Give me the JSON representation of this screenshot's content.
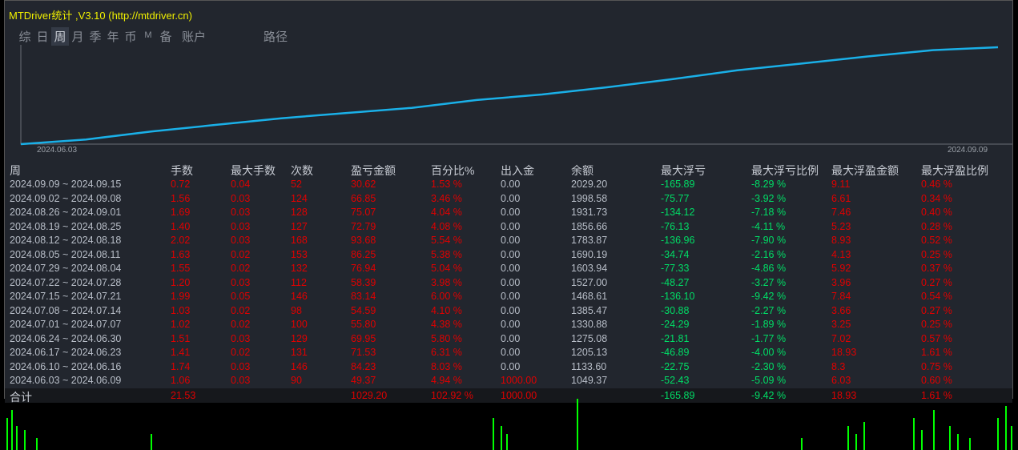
{
  "title": "MTDriver统计 ,V3.10 (http://mtdriver.cn)",
  "tabs": [
    "综",
    "日",
    "周",
    "月",
    "季",
    "年",
    "币",
    "M",
    "备",
    "账户",
    "路径"
  ],
  "active_tab": "周",
  "chart": {
    "x_start": "2024.06.03",
    "x_end": "2024.09.09",
    "line_color": "#1ab0e8"
  },
  "columns": [
    "周",
    "手数",
    "最大手数",
    "次数",
    "盈亏金额",
    "百分比%",
    "出入金",
    "余额",
    "最大浮亏",
    "最大浮亏比例",
    "最大浮盈金额",
    "最大浮盈比例"
  ],
  "rows": [
    [
      "2024.09.09 ~ 2024.09.15",
      "0.72",
      "0.04",
      "52",
      "30.62",
      "1.53 %",
      "0.00",
      "2029.20",
      "-165.89",
      "-8.29 %",
      "9.11",
      "0.46 %"
    ],
    [
      "2024.09.02 ~ 2024.09.08",
      "1.56",
      "0.03",
      "124",
      "66.85",
      "3.46 %",
      "0.00",
      "1998.58",
      "-75.77",
      "-3.92 %",
      "6.61",
      "0.34 %"
    ],
    [
      "2024.08.26 ~ 2024.09.01",
      "1.69",
      "0.03",
      "128",
      "75.07",
      "4.04 %",
      "0.00",
      "1931.73",
      "-134.12",
      "-7.18 %",
      "7.46",
      "0.40 %"
    ],
    [
      "2024.08.19 ~ 2024.08.25",
      "1.40",
      "0.03",
      "127",
      "72.79",
      "4.08 %",
      "0.00",
      "1856.66",
      "-76.13",
      "-4.11 %",
      "5.23",
      "0.28 %"
    ],
    [
      "2024.08.12 ~ 2024.08.18",
      "2.02",
      "0.03",
      "168",
      "93.68",
      "5.54 %",
      "0.00",
      "1783.87",
      "-136.96",
      "-7.90 %",
      "8.93",
      "0.52 %"
    ],
    [
      "2024.08.05 ~ 2024.08.11",
      "1.63",
      "0.02",
      "153",
      "86.25",
      "5.38 %",
      "0.00",
      "1690.19",
      "-34.74",
      "-2.16 %",
      "4.13",
      "0.25 %"
    ],
    [
      "2024.07.29 ~ 2024.08.04",
      "1.55",
      "0.02",
      "132",
      "76.94",
      "5.04 %",
      "0.00",
      "1603.94",
      "-77.33",
      "-4.86 %",
      "5.92",
      "0.37 %"
    ],
    [
      "2024.07.22 ~ 2024.07.28",
      "1.20",
      "0.03",
      "112",
      "58.39",
      "3.98 %",
      "0.00",
      "1527.00",
      "-48.27",
      "-3.27 %",
      "3.96",
      "0.27 %"
    ],
    [
      "2024.07.15 ~ 2024.07.21",
      "1.99",
      "0.05",
      "146",
      "83.14",
      "6.00 %",
      "0.00",
      "1468.61",
      "-136.10",
      "-9.42 %",
      "7.84",
      "0.54 %"
    ],
    [
      "2024.07.08 ~ 2024.07.14",
      "1.03",
      "0.02",
      "98",
      "54.59",
      "4.10 %",
      "0.00",
      "1385.47",
      "-30.88",
      "-2.27 %",
      "3.66",
      "0.27 %"
    ],
    [
      "2024.07.01 ~ 2024.07.07",
      "1.02",
      "0.02",
      "100",
      "55.80",
      "4.38 %",
      "0.00",
      "1330.88",
      "-24.29",
      "-1.89 %",
      "3.25",
      "0.25 %"
    ],
    [
      "2024.06.24 ~ 2024.06.30",
      "1.51",
      "0.03",
      "129",
      "69.95",
      "5.80 %",
      "0.00",
      "1275.08",
      "-21.81",
      "-1.77 %",
      "7.02",
      "0.57 %"
    ],
    [
      "2024.06.17 ~ 2024.06.23",
      "1.41",
      "0.02",
      "131",
      "71.53",
      "6.31 %",
      "0.00",
      "1205.13",
      "-46.89",
      "-4.00 %",
      "18.93",
      "1.61 %"
    ],
    [
      "2024.06.10 ~ 2024.06.16",
      "1.74",
      "0.03",
      "146",
      "84.23",
      "8.03 %",
      "0.00",
      "1133.60",
      "-22.75",
      "-2.30 %",
      "8.3",
      "0.75 %"
    ],
    [
      "2024.06.03 ~ 2024.06.09",
      "1.06",
      "0.03",
      "90",
      "49.37",
      "4.94 %",
      "1000.00",
      "1049.37",
      "-52.43",
      "-5.09 %",
      "6.03",
      "0.60 %"
    ]
  ],
  "total": [
    "合计",
    "21.53",
    "",
    "",
    "1029.20",
    "102.92 %",
    "1000.00",
    "",
    "-165.89",
    "-9.42 %",
    "18.93",
    "1.61 %"
  ]
}
